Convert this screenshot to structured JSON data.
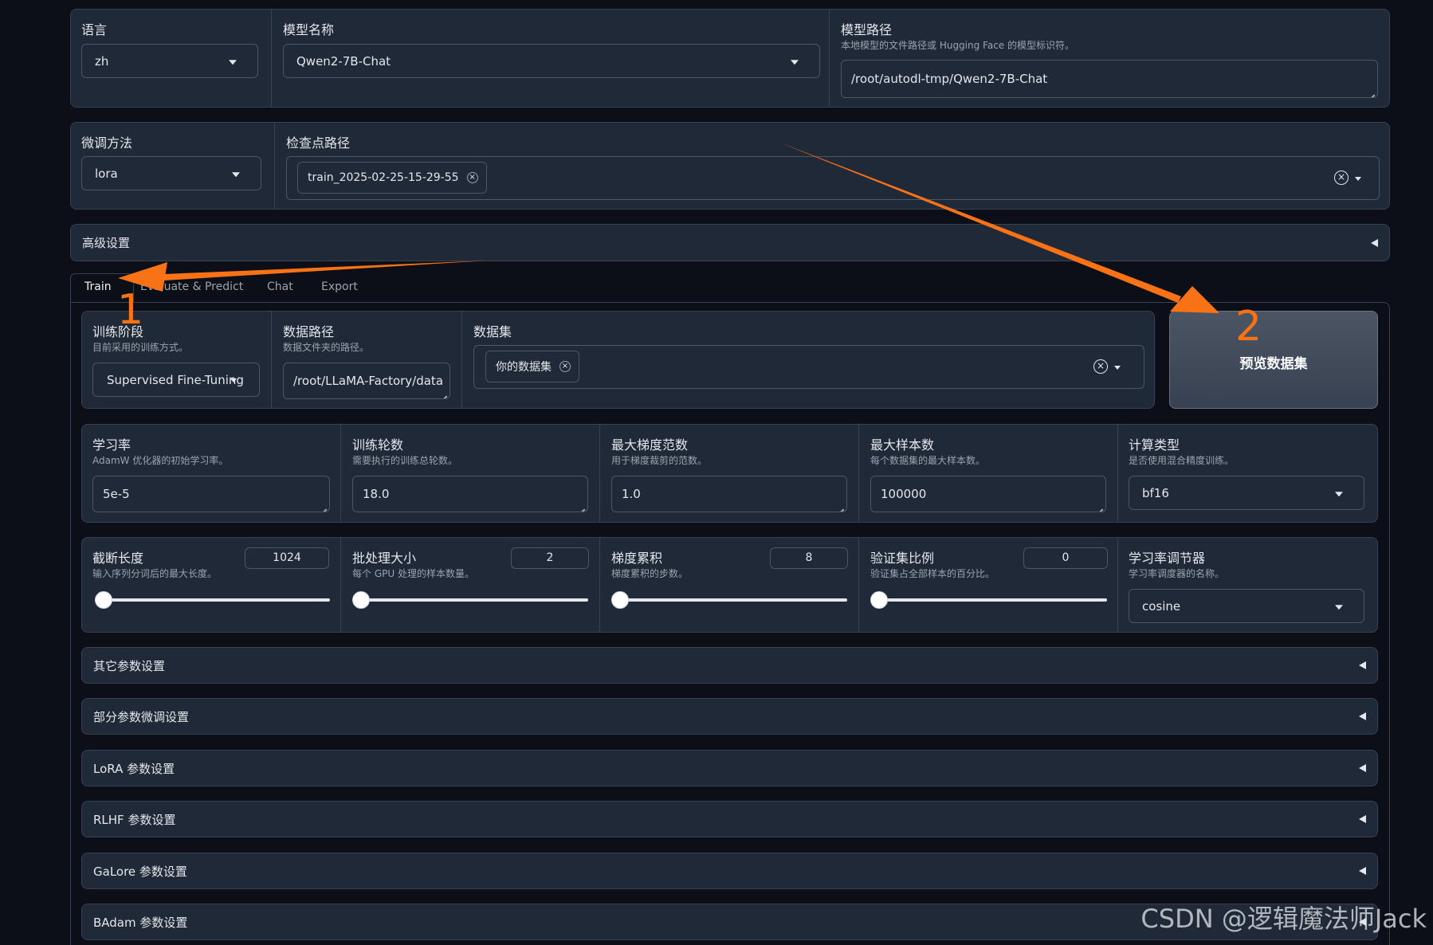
{
  "top": {
    "language_label": "语言",
    "language_value": "zh",
    "model_name_label": "模型名称",
    "model_name_value": "Qwen2-7B-Chat",
    "model_path_label": "模型路径",
    "model_path_info": "本地模型的文件路径或 Hugging Face 的模型标识符。",
    "model_path_value": "/root/autodl-tmp/Qwen2-7B-Chat"
  },
  "row2": {
    "finetune_label": "微调方法",
    "finetune_value": "lora",
    "checkpoint_label": "检查点路径",
    "checkpoint_chip": "train_2025-02-25-15-29-55",
    "chip_close": "×",
    "clear_symbol": "×"
  },
  "advanced": {
    "label": "高级设置"
  },
  "tabs": [
    {
      "label": "Train"
    },
    {
      "label": "Evaluate & Predict"
    },
    {
      "label": "Chat"
    },
    {
      "label": "Export"
    }
  ],
  "train_row1": {
    "stage_label": "训练阶段",
    "stage_info": "目前采用的训练方式。",
    "stage_value": "Supervised Fine-Tuning",
    "data_dir_label": "数据路径",
    "data_dir_info": "数据文件夹的路径。",
    "data_dir_value": "/root/LLaMA-Factory/data",
    "dataset_label": "数据集",
    "dataset_chip": "你的数据集",
    "preview_button": "预览数据集"
  },
  "train_row2": [
    {
      "label": "学习率",
      "info": "AdamW 优化器的初始学习率。",
      "value": "5e-5"
    },
    {
      "label": "训练轮数",
      "info": "需要执行的训练总轮数。",
      "value": "18.0"
    },
    {
      "label": "最大梯度范数",
      "info": "用于梯度裁剪的范数。",
      "value": "1.0"
    },
    {
      "label": "最大样本数",
      "info": "每个数据集的最大样本数。",
      "value": "100000"
    },
    {
      "label": "计算类型",
      "info": "是否使用混合精度训练。",
      "value": "bf16"
    }
  ],
  "train_row3": [
    {
      "label": "截断长度",
      "info": "输入序列分词后的最大长度。",
      "value": "1024",
      "level": 0.0
    },
    {
      "label": "批处理大小",
      "info": "每个 GPU 处理的样本数量。",
      "value": "2",
      "level": 0.0
    },
    {
      "label": "梯度累积",
      "info": "梯度累积的步数。",
      "value": "8",
      "level": 0.0
    },
    {
      "label": "验证集比例",
      "info": "验证集占全部样本的百分比。",
      "value": "0",
      "level": 0.0
    },
    {
      "label": "学习率调节器",
      "info": "学习率调度器的名称。",
      "value": "cosine"
    }
  ],
  "accordions": [
    {
      "label": "其它参数设置"
    },
    {
      "label": "部分参数微调设置"
    },
    {
      "label": "LoRA 参数设置"
    },
    {
      "label": "RLHF 参数设置"
    },
    {
      "label": "GaLore 参数设置"
    },
    {
      "label": "BAdam 参数设置"
    }
  ],
  "annotations": {
    "one": "1",
    "two": "2",
    "color": "#f97316"
  },
  "watermark": "CSDN @逻辑魔法师Jack"
}
